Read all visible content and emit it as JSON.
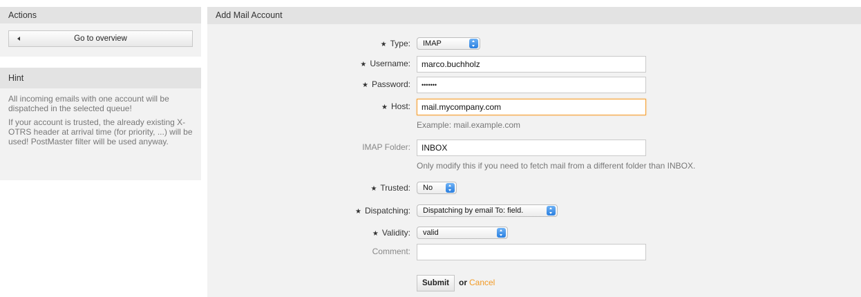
{
  "sidebar": {
    "actions": {
      "title": "Actions",
      "overview_label": "Go to overview"
    },
    "hint": {
      "title": "Hint",
      "paragraphs": [
        "All incoming emails with one account will be dispatched in the selected queue!",
        "If your account is trusted, the already existing X-OTRS header at arrival time (for priority, ...) will be used! PostMaster filter will be used anyway."
      ]
    }
  },
  "main": {
    "title": "Add Mail Account",
    "form": {
      "type": {
        "label": "Type:",
        "required": true,
        "value": "IMAP"
      },
      "username": {
        "label": "Username:",
        "required": true,
        "value": "marco.buchholz"
      },
      "password": {
        "label": "Password:",
        "required": true,
        "value": "•••••••"
      },
      "host": {
        "label": "Host:",
        "required": true,
        "value": "mail.mycompany.com",
        "hint": "Example: mail.example.com"
      },
      "imap_folder": {
        "label": "IMAP Folder:",
        "required": false,
        "value": "INBOX",
        "hint": "Only modify this if you need to fetch mail from a different folder than INBOX."
      },
      "trusted": {
        "label": "Trusted:",
        "required": true,
        "value": "No"
      },
      "dispatching": {
        "label": "Dispatching:",
        "required": true,
        "value": "Dispatching by email To: field."
      },
      "validity": {
        "label": "Validity:",
        "required": true,
        "value": "valid"
      },
      "comment": {
        "label": "Comment:",
        "required": false,
        "value": ""
      },
      "submit_label": "Submit",
      "or_label": "or",
      "cancel_label": "Cancel"
    }
  },
  "colors": {
    "accent": "#f29a25",
    "focus_border": "#f5a033",
    "select_knob": "#2a7fe0",
    "panel_bg": "#f2f2f2",
    "header_bg": "#e3e3e3"
  },
  "icons": {
    "required_marker": "star-icon",
    "back_arrow": "triangle-left-icon",
    "select_arrows": "updown-chevron-icon"
  }
}
